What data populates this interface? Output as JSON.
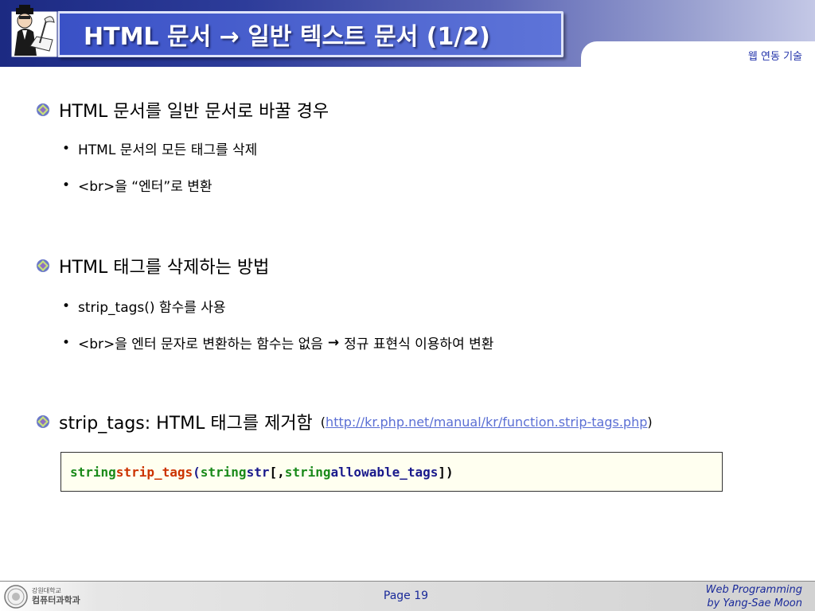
{
  "header": {
    "title": "HTML 문서 → 일반 텍스트 문서 (1/2)",
    "subtitle": "웹 연동 기술"
  },
  "sections": [
    {
      "heading": "HTML 문서를 일반 문서로 바꿀 경우",
      "bullets": [
        "HTML 문서의 모든 태그를 삭제",
        "<br>을 “엔터”로 변환"
      ]
    },
    {
      "heading": "HTML 태그를 삭제하는 방법",
      "bullets": [
        "strip_tags() 함수를 사용",
        {
          "before": "<br>을 엔터 문자로 변환하는 함수는 없음",
          "after": "정규 표현식 이용하여 변환"
        }
      ]
    },
    {
      "heading": "strip_tags: HTML 태그를 제거함",
      "link_open": "(",
      "link": "http://kr.php.net/manual/kr/function.strip-tags.php",
      "link_close": ")"
    }
  ],
  "code": {
    "tokens": [
      "string",
      "strip_tags",
      "(",
      "string",
      "str",
      "[,",
      "string",
      "allowable_tags",
      "])"
    ]
  },
  "footer": {
    "univ_top": "강원대학교",
    "univ_dept": "컴퓨터과학과",
    "page": "Page 19",
    "course": "Web Programming",
    "author": "by Yang-Sae Moon"
  },
  "colors": {
    "header_dark": "#1c2a82",
    "title_box": "#3a51c6",
    "link": "#5b6fd4",
    "code_green": "#1a8a1a",
    "code_red": "#cc3300",
    "code_navy": "#1a1a8c",
    "footer_text": "#1a2a9a"
  },
  "icons": [
    "scholar-logo-icon",
    "diamond-bullet-icon",
    "right-arrow-icon",
    "university-seal-icon"
  ]
}
